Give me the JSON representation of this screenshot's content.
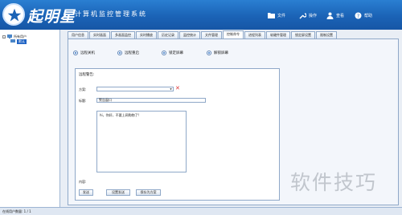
{
  "app": {
    "logo_text": "起明星",
    "name": "计算机监控管理系统"
  },
  "top_menu": [
    {
      "label": "文件",
      "icon": "folder-icon"
    },
    {
      "label": "操作",
      "icon": "wrench-icon"
    },
    {
      "label": "查看",
      "icon": "person-icon"
    },
    {
      "label": "帮助",
      "icon": "help-icon"
    }
  ],
  "tree": {
    "root": "所有用户",
    "child": "默认"
  },
  "tabs": [
    "用户信息",
    "实时画面",
    "多画面监控",
    "实时播放",
    "历史记录",
    "监控统计",
    "文件管理",
    "控制命令",
    "进程列表",
    "软硬件管理",
    "锁定屏设置",
    "限制设置"
  ],
  "active_tab_index": 7,
  "radios": [
    "远程关机",
    "远程重启",
    "锁定屏幕",
    "解锁屏幕"
  ],
  "form": {
    "box_title": "远程警告:",
    "type_label": "方案:",
    "title_label": "标题:",
    "title_value": "警告窗口",
    "content_label": "内容:",
    "content_value": "hi，你好，不要上网购物了!",
    "buttons": [
      "发送",
      "设置发送",
      "保存为方案"
    ]
  },
  "status": {
    "online_label": "在线用户数量:",
    "online_value": "1 / 1"
  },
  "watermark": "软件技巧",
  "colors": {
    "titlebar": "#1b63b6",
    "selected": "#1f63c4",
    "close_x": "#dd3333"
  }
}
